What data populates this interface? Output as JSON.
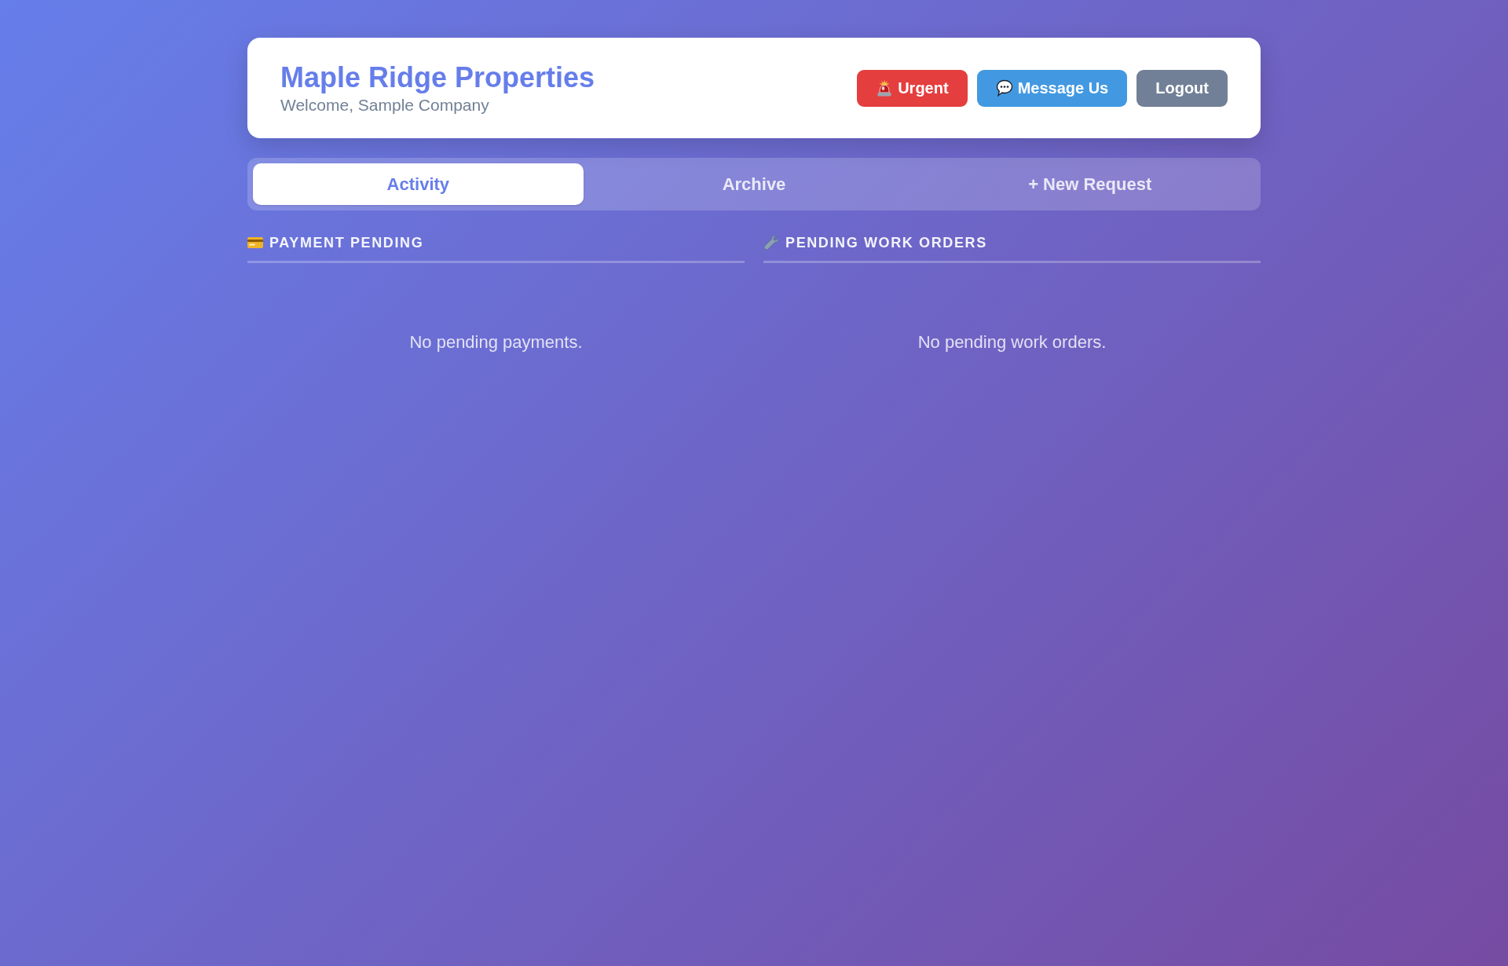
{
  "header": {
    "title": "Maple Ridge Properties",
    "subtitle": "Welcome, Sample Company",
    "buttons": [
      {
        "kind": "urgent",
        "label": "Urgent"
      },
      {
        "kind": "message",
        "label": "Message Us"
      },
      {
        "kind": "logout",
        "label": "Logout"
      }
    ]
  },
  "tabs": [
    {
      "label": "Activity",
      "selected": true
    },
    {
      "label": "Archive",
      "selected": false
    },
    {
      "label": "+ New Request",
      "selected": false
    }
  ],
  "sections": [
    {
      "kind": "payments",
      "heading": "PAYMENT PENDING",
      "empty_message": "No pending payments."
    },
    {
      "kind": "work_orders",
      "heading": "PENDING WORK ORDERS",
      "empty_message": "No pending work orders."
    }
  ]
}
